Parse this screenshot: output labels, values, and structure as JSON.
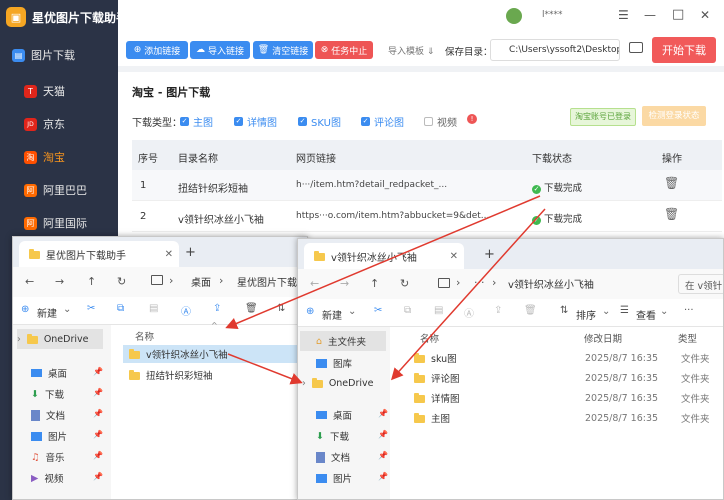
{
  "app": {
    "title": "星优图片下载助手",
    "user": "l****",
    "window_min": "—",
    "window_max": "□",
    "window_close": "✕",
    "menu_icon": "☰"
  },
  "sidebar": {
    "items": [
      {
        "label": "图片下载",
        "icon": "图",
        "color": "#3b8cf0"
      },
      {
        "label": "天猫",
        "icon": "T",
        "color": "#e0261b"
      },
      {
        "label": "京东",
        "icon": "JD",
        "color": "#e1251b"
      },
      {
        "label": "淘宝",
        "icon": "淘",
        "color": "#ff5000"
      },
      {
        "label": "阿里巴巴",
        "icon": "阿",
        "color": "#ff6a00"
      },
      {
        "label": "阿里国际",
        "icon": "阿",
        "color": "#ff6a00"
      }
    ]
  },
  "toolbar": {
    "add_link": "添加链接",
    "import_link": "导入链接",
    "clear_link": "清空链接",
    "stop_task": "任务中止",
    "import_template": "导入模板 ⇓",
    "save_dir_label": "保存目录：",
    "save_dir": "C:\\Users\\yssoft2\\Desktop",
    "start": "开始下载"
  },
  "main": {
    "title": "淘宝 - 图片下载",
    "download_type_label": "下载类型：",
    "types": [
      "主图",
      "详情图",
      "SKU图",
      "评论图",
      "视频"
    ],
    "login_status": "淘宝账号已登录",
    "check_login": "检测登录状态",
    "columns": [
      "序号",
      "目录名称",
      "网页链接",
      "下载状态",
      "操作"
    ],
    "rows": [
      {
        "no": "1",
        "name": "扭结针织彩短袖",
        "link": "h···/item.htm?detail_redpacket_...",
        "status": "下载完成"
      },
      {
        "no": "2",
        "name": "v领针织冰丝小飞袖",
        "link": "https···o.com/item.htm?abbucket=9&det...",
        "status": "下载完成"
      }
    ]
  },
  "explorer_left": {
    "tab": "星优图片下载助手",
    "new_tab": "+",
    "addr_home": "桌面",
    "addr_folder": "星优图片下载助",
    "new": "新建",
    "col_name": "名称",
    "items": [
      "v领针织冰丝小飞袖",
      "扭结针织彩短袖"
    ],
    "nav": [
      "OneDrive",
      "桌面",
      "下载",
      "文档",
      "图片",
      "音乐",
      "视频"
    ]
  },
  "explorer_right": {
    "tab": "v领针织冰丝小飞袖",
    "new_tab": "+",
    "addr": "v领针织冰丝小飞袖",
    "search": "在 v领针",
    "new": "新建",
    "sort": "排序",
    "view": "查看",
    "more": "···",
    "cols": [
      "名称",
      "修改日期",
      "类型"
    ],
    "items": [
      {
        "name": "sku图",
        "date": "2025/8/7 16:35",
        "type": "文件夹"
      },
      {
        "name": "评论图",
        "date": "2025/8/7 16:35",
        "type": "文件夹"
      },
      {
        "name": "详情图",
        "date": "2025/8/7 16:35",
        "type": "文件夹"
      },
      {
        "name": "主图",
        "date": "2025/8/7 16:35",
        "type": "文件夹"
      }
    ],
    "nav": [
      "主文件夹",
      "图库",
      "OneDrive",
      "桌面",
      "下载",
      "文档",
      "图片"
    ]
  }
}
